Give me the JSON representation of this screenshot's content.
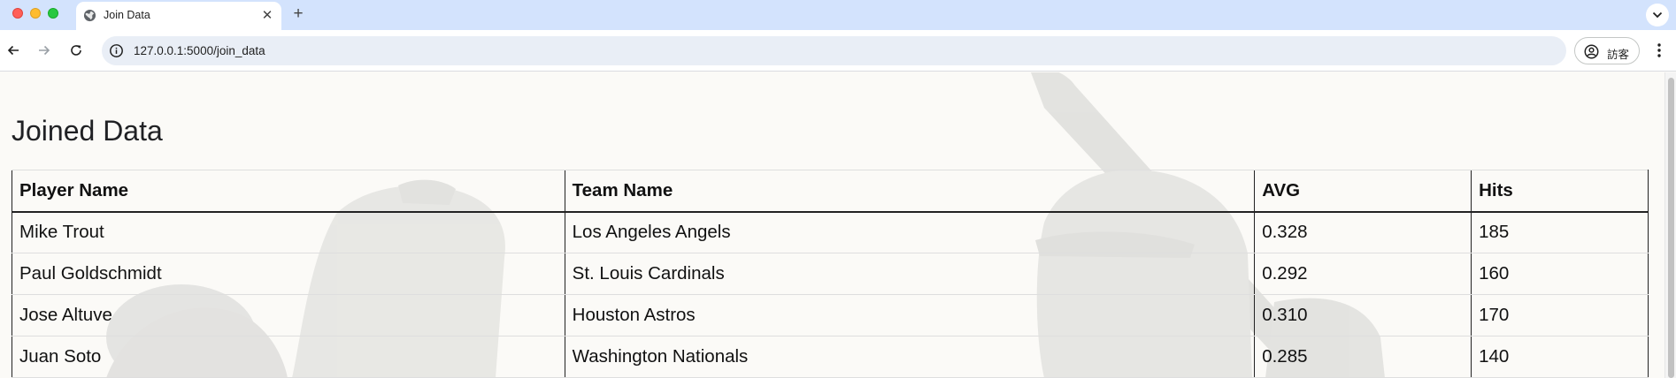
{
  "browser": {
    "tab_title": "Join Data",
    "url": "127.0.0.1:5000/join_data",
    "profile_label": "訪客"
  },
  "page": {
    "title": "Joined Data",
    "table": {
      "headers": [
        "Player Name",
        "Team Name",
        "AVG",
        "Hits"
      ],
      "rows": [
        [
          "Mike Trout",
          "Los Angeles Angels",
          "0.328",
          "185"
        ],
        [
          "Paul Goldschmidt",
          "St. Louis Cardinals",
          "0.292",
          "160"
        ],
        [
          "Jose Altuve",
          "Houston Astros",
          "0.310",
          "170"
        ],
        [
          "Juan Soto",
          "Washington Nationals",
          "0.285",
          "140"
        ]
      ]
    }
  },
  "theme": {
    "tabbar_bg": "#d3e3fd",
    "omnibox_bg": "#e9eef6",
    "page_bg": "#fbfaf7"
  }
}
